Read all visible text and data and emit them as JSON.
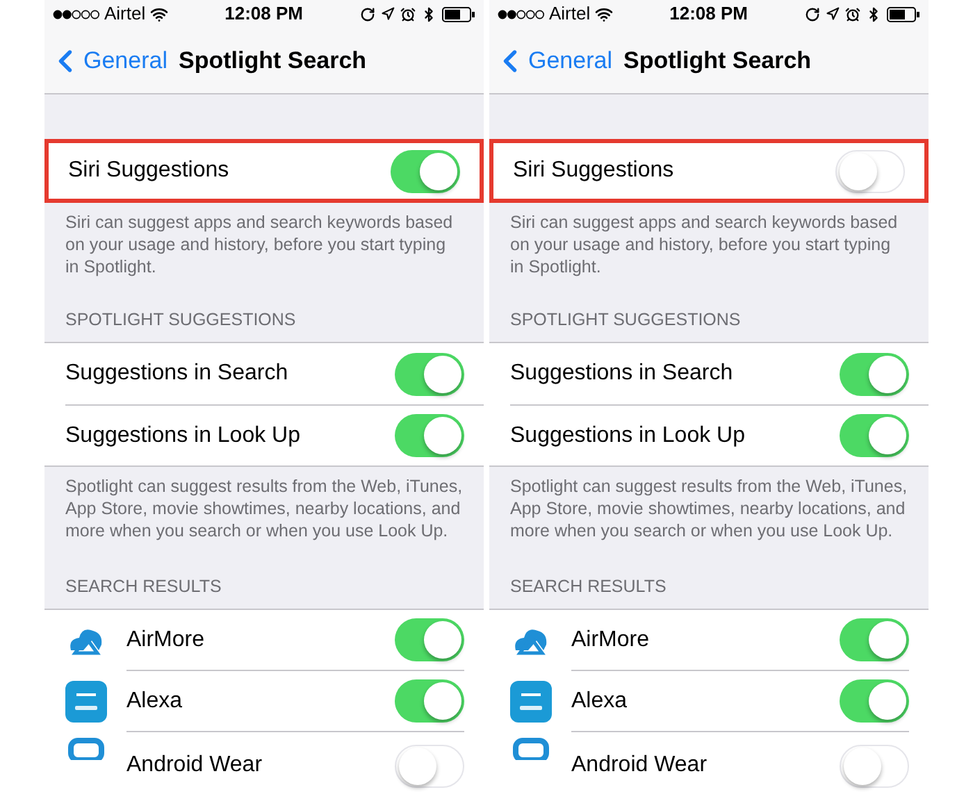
{
  "phones": [
    {
      "status_bar": {
        "carrier": "Airtel",
        "time": "12:08 PM"
      },
      "nav": {
        "back": "General",
        "title": "Spotlight Search"
      },
      "siri": {
        "label": "Siri Suggestions",
        "on": true,
        "highlighted": true
      },
      "siri_description": "Siri can suggest apps and search keywords based on your usage and history, before you start typing in Spotlight.",
      "spotlight_header": "SPOTLIGHT SUGGESTIONS",
      "spotlight_rows": [
        {
          "label": "Suggestions in Search",
          "on": true
        },
        {
          "label": "Suggestions in Look Up",
          "on": true
        }
      ],
      "spotlight_description": "Spotlight can suggest results from the Web, iTunes, App Store, movie showtimes, nearby locations, and more when you search or when you use Look Up.",
      "results_header": "SEARCH RESULTS",
      "apps": [
        {
          "kind": "cloud",
          "label": "AirMore",
          "on": true
        },
        {
          "kind": "speaker",
          "label": "Alexa",
          "on": true
        },
        {
          "kind": "watch",
          "label": "Android Wear",
          "on": false
        }
      ]
    },
    {
      "status_bar": {
        "carrier": "Airtel",
        "time": "12:08 PM"
      },
      "nav": {
        "back": "General",
        "title": "Spotlight Search"
      },
      "siri": {
        "label": "Siri Suggestions",
        "on": false,
        "highlighted": true
      },
      "siri_description": "Siri can suggest apps and search keywords based on your usage and history, before you start typing in Spotlight.",
      "spotlight_header": "SPOTLIGHT SUGGESTIONS",
      "spotlight_rows": [
        {
          "label": "Suggestions in Search",
          "on": true
        },
        {
          "label": "Suggestions in Look Up",
          "on": true
        }
      ],
      "spotlight_description": "Spotlight can suggest results from the Web, iTunes, App Store, movie showtimes, nearby locations, and more when you search or when you use Look Up.",
      "results_header": "SEARCH RESULTS",
      "apps": [
        {
          "kind": "cloud",
          "label": "AirMore",
          "on": true
        },
        {
          "kind": "speaker",
          "label": "Alexa",
          "on": true
        },
        {
          "kind": "watch",
          "label": "Android Wear",
          "on": false
        }
      ]
    }
  ]
}
